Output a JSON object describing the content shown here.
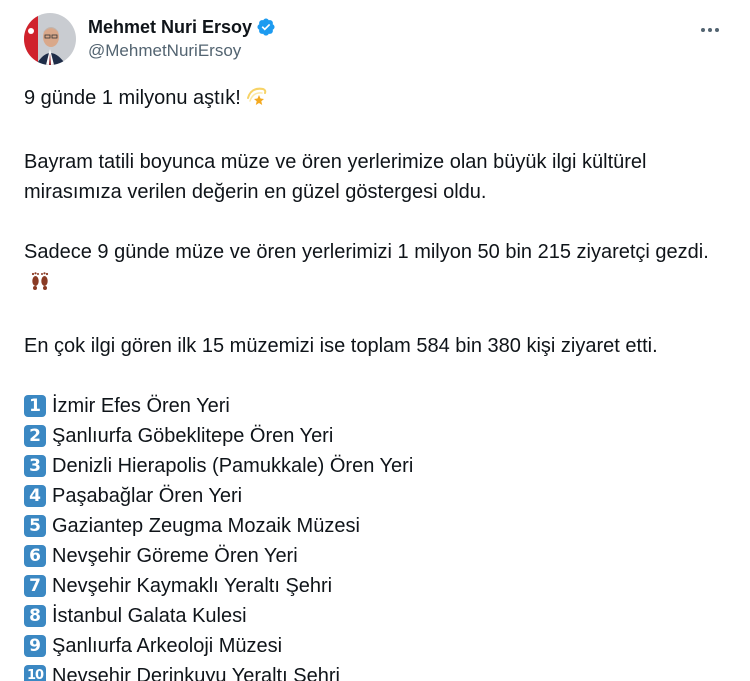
{
  "author": {
    "display_name": "Mehmet Nuri Ersoy",
    "handle": "@MehmetNuriErsoy"
  },
  "icons": {
    "verified": "verified-badge-icon",
    "more": "more-horizontal-icon",
    "dizzy": "dizzy-star-emoji",
    "footprints": "footprints-emoji"
  },
  "colors": {
    "verified": "#1d9bf0",
    "keycap": "#3b88c3",
    "secondary_text": "#536471"
  },
  "tweet": {
    "line1": "9 günde 1 milyonu aştık!",
    "para2": "Bayram tatili boyunca müze ve ören yerlerimize olan büyük ilgi kültürel mirasımıza verilen değerin en güzel göstergesi oldu.",
    "para3": "Sadece 9 günde müze ve ören yerlerimizi 1 milyon 50 bin 215 ziyaretçi gezdi.",
    "para4": "En çok ilgi gören ilk 15 müzemizi ise toplam 584 bin 380 kişi ziyaret etti.",
    "list": [
      {
        "num": "1",
        "text": "İzmir Efes Ören Yeri"
      },
      {
        "num": "2",
        "text": "Şanlıurfa Göbeklitepe Ören Yeri"
      },
      {
        "num": "3",
        "text": "Denizli Hierapolis (Pamukkale) Ören Yeri"
      },
      {
        "num": "4",
        "text": "Paşabağlar Ören Yeri"
      },
      {
        "num": "5",
        "text": "Gaziantep Zeugma Mozaik Müzesi"
      },
      {
        "num": "6",
        "text": "Nevşehir Göreme Ören Yeri"
      },
      {
        "num": "7",
        "text": "Nevşehir Kaymaklı Yeraltı Şehri"
      },
      {
        "num": "8",
        "text": "İstanbul Galata Kulesi"
      },
      {
        "num": "9",
        "text": "Şanlıurfa Arkeoloji Müzesi"
      },
      {
        "num": "10",
        "text": "Nevşehir Derinkuyu Yeraltı Şehri"
      }
    ]
  }
}
